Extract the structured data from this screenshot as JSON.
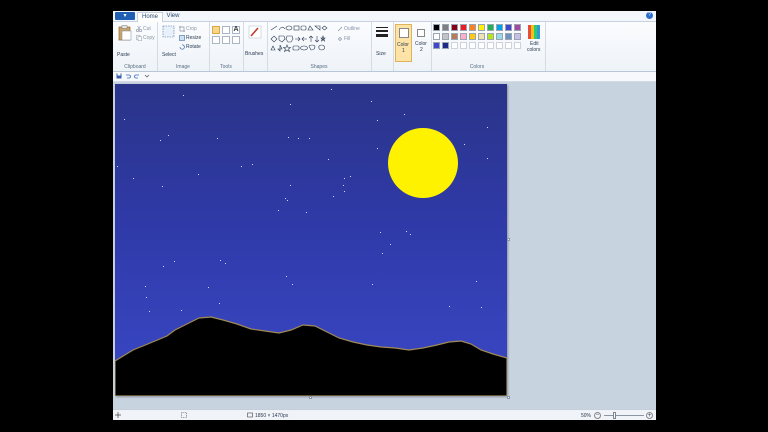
{
  "tabs": {
    "file_label": "▾",
    "home": "Home",
    "view": "View",
    "help": "?"
  },
  "ribbon": {
    "clipboard": {
      "paste": "Paste",
      "cut": "Cut",
      "copy": "Copy",
      "group": "Clipboard"
    },
    "image": {
      "select": "Select",
      "crop": "Crop",
      "resize": "Resize",
      "rotate": "Rotate",
      "group": "Image"
    },
    "tools": {
      "group": "Tools",
      "brushes": "Brushes"
    },
    "shapes": {
      "outline": "Outline",
      "fill": "Fill",
      "group": "Shapes"
    },
    "size": "Size",
    "color1": "Color\n1",
    "color1_a": "Color",
    "color1_b": "1",
    "color2_a": "Color",
    "color2_b": "2",
    "colors_group": "Colors",
    "edit_colors_a": "Edit",
    "edit_colors_b": "colors",
    "palette_row1": [
      "#000000",
      "#7f7f7f",
      "#880015",
      "#ed1c24",
      "#ff7f27",
      "#fff200",
      "#22b14c",
      "#00a2e8",
      "#3f48cc",
      "#a349a4"
    ],
    "palette_row2": [
      "#ffffff",
      "#c3c3c3",
      "#b97a57",
      "#ffaec9",
      "#ffc90e",
      "#efe4b0",
      "#b5e61d",
      "#99d9ea",
      "#7092be",
      "#c8bfe7"
    ],
    "palette_row3": [
      "#3f48cc",
      "#1e2a8a",
      "",
      "",
      "",
      "",
      "",
      "",
      "",
      ""
    ],
    "color1_value": "#ffffff",
    "color2_value": "#ffffff"
  },
  "statusbar": {
    "dimensions": "1850 × 1470px",
    "zoom": "50%",
    "zoom_out": "−",
    "zoom_in": "+"
  },
  "painting": {
    "sky_top": "#2a3488",
    "sky_bottom": "#3a48c6",
    "moon_color": "#fff200",
    "mountain_color": "#000000"
  }
}
